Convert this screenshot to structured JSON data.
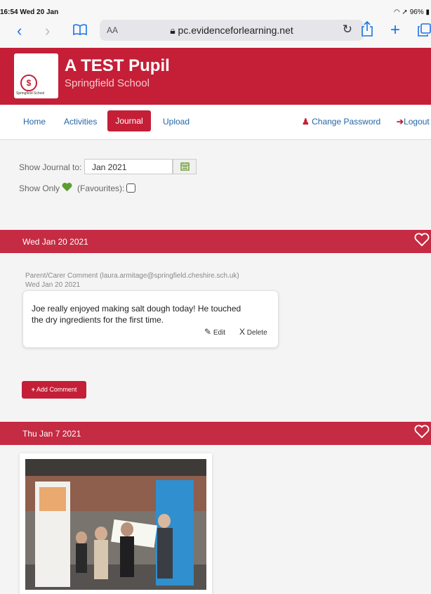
{
  "status": {
    "time": "16:54  Wed 20 Jan",
    "battery": "96%"
  },
  "browser": {
    "aa": "AA",
    "url": "pc.evidenceforlearning.net"
  },
  "header": {
    "pupil_name": "A TEST Pupil",
    "school_name": "Springfield School",
    "logo_text": "Springfield School"
  },
  "nav": {
    "home": "Home",
    "activities": "Activities",
    "journal": "Journal",
    "upload": "Upload",
    "change_password": "Change Password",
    "logout": "Logout"
  },
  "filters": {
    "show_journal_label": "Show Journal to:",
    "date_value": "Jan 2021",
    "show_only": "Show Only",
    "favourites": "(Favourites):"
  },
  "entries": [
    {
      "date": "Wed Jan 20 2021",
      "comment": {
        "author_line": "Parent/Carer Comment (laura.armitage@springfield.cheshire.sch.uk)",
        "date": "Wed Jan 20 2021",
        "text": "Joe really enjoyed making salt dough today! He touched the dry ingredients for the first time.",
        "edit": "Edit",
        "delete": "Delete"
      },
      "add_comment": "Add Comment"
    },
    {
      "date": "Thu Jan 7 2021"
    }
  ],
  "colors": {
    "brand_red": "#c41f37",
    "nav_blue": "#2366a8",
    "favourite_green": "#5a9e2f"
  }
}
